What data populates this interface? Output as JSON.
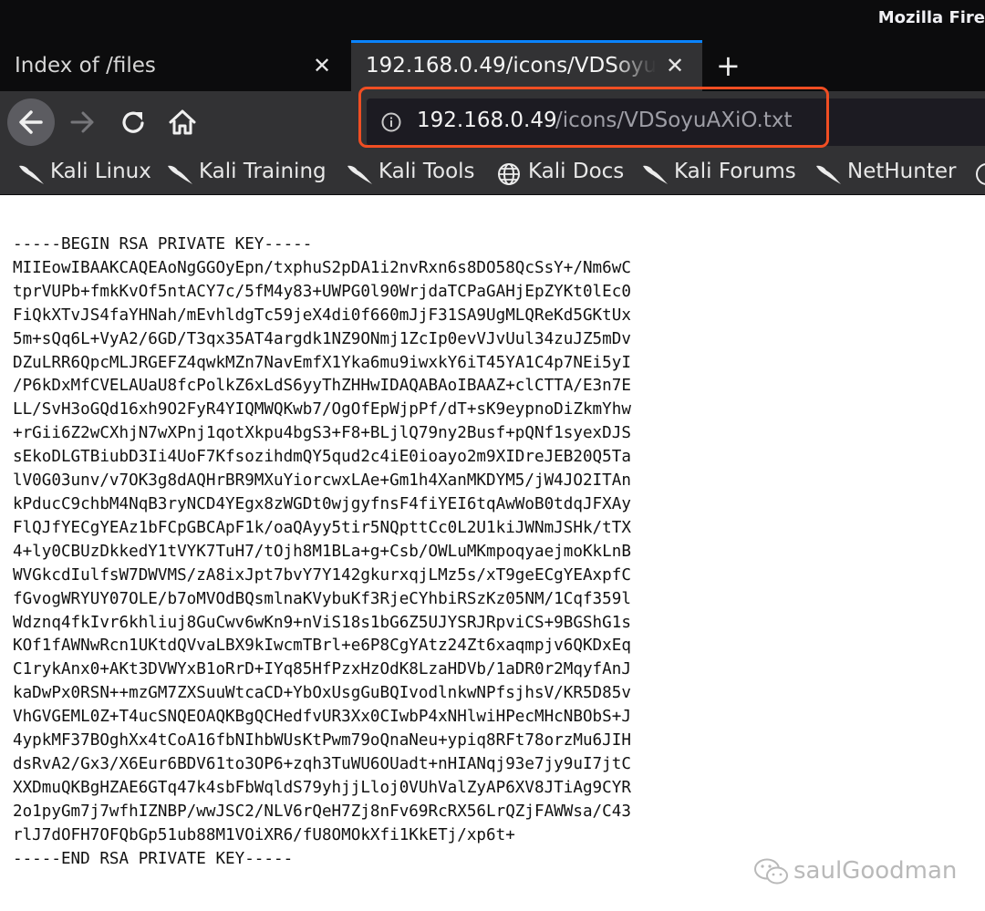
{
  "window": {
    "title": "Mozilla Fire"
  },
  "tabs": [
    {
      "label": "Index of /files",
      "active": false
    },
    {
      "label": "192.168.0.49/icons/VDSoyuAXiO.txt",
      "active": true
    }
  ],
  "nav": {
    "url_host": "192.168.0.49",
    "url_path": "/icons/VDSoyuAXiO.txt"
  },
  "bookmarks": [
    {
      "label": "Kali Linux",
      "icon": "kali-dragon-icon"
    },
    {
      "label": "Kali Training",
      "icon": "kali-dragon-icon"
    },
    {
      "label": "Kali Tools",
      "icon": "kali-dragon-icon"
    },
    {
      "label": "Kali Docs",
      "icon": "globe-icon"
    },
    {
      "label": "Kali Forums",
      "icon": "kali-dragon-icon"
    },
    {
      "label": "NetHunter",
      "icon": "kali-dragon-icon"
    }
  ],
  "document": {
    "lines": [
      "-----BEGIN RSA PRIVATE KEY-----",
      "MIIEowIBAAKCAQEAoNgGGOyEpn/txphuS2pDA1i2nvRxn6s8DO58QcSsY+/Nm6wC",
      "tprVUPb+fmkKvOf5ntACY7c/5fM4y83+UWPG0l90WrjdaTCPaGAHjEpZYKt0lEc0",
      "FiQkXTvJS4faYHNah/mEvhldgTc59jeX4di0f660mJjF31SA9UgMLQReKd5GKtUx",
      "5m+sQq6L+VyA2/6GD/T3qx35AT4argdk1NZ9ONmj1ZcIp0evVJvUul34zuJZ5mDv",
      "DZuLRR6QpcMLJRGEFZ4qwkMZn7NavEmfX1Yka6mu9iwxkY6iT45YA1C4p7NEi5yI",
      "/P6kDxMfCVELAUaU8fcPolkZ6xLdS6yyThZHHwIDAQABAoIBAAZ+clCTTA/E3n7E",
      "LL/SvH3oGQd16xh9O2FyR4YIQMWQKwb7/OgOfEpWjpPf/dT+sK9eypnoDiZkmYhw",
      "+rGii6Z2wCXhjN7wXPnj1qotXkpu4bgS3+F8+BLjlQ79ny2Busf+pQNf1syexDJS",
      "sEkoDLGTBiubD3Ii4UoF7KfsozihdmQY5qud2c4iE0ioayo2m9XIDreJEB20Q5Ta",
      "lV0G03unv/v7OK3g8dAQHrBR9MXuYiorcwxLAe+Gm1h4XanMKDYM5/jW4JO2ITAn",
      "kPducC9chbM4NqB3ryNCD4YEgx8zWGDt0wjgyfnsF4fiYEI6tqAwWoB0tdqJFXAy",
      "FlQJfYECgYEAz1bFCpGBCApF1k/oaQAyy5tir5NQpttCc0L2U1kiJWNmJSHk/tTX",
      "4+ly0CBUzDkkedY1tVYK7TuH7/tOjh8M1BLa+g+Csb/OWLuMKmpoqyaejmoKkLnB",
      "WVGkcdIulfsW7DWVMS/zA8ixJpt7bvY7Y142gkurxqjLMz5s/xT9geECgYEAxpfC",
      "fGvogWRYUY07OLE/b7oMVOdBQsmlnaKVybuKf3RjeCYhbiRSzKz05NM/1Cqf359l",
      "Wdznq4fkIvr6khliuj8GuCwv6wKn9+nViS18s1bG6Z5UJYSRJRpviCS+9BGShG1s",
      "KOf1fAWNwRcn1UKtdQVvaLBX9kIwcmTBrl+e6P8CgYAtz24Zt6xaqmpjv6QKDxEq",
      "C1rykAnx0+AKt3DVWYxB1oRrD+IYq85HfPzxHzOdK8LzaHDVb/1aDR0r2MqyfAnJ",
      "kaDwPx0RSN++mzGM7ZXSuuWtcaCD+YbOxUsgGuBQIvodlnkwNPfsjhsV/KR5D85v",
      "VhGVGEML0Z+T4ucSNQEOAQKBgQCHedfvUR3Xx0CIwbP4xNHlwiHPecMHcNBObS+J",
      "4ypkMF37BOghXx4tCoA16fbNIhbWUsKtPwm79oQnaNeu+ypiq8RFt78orzMu6JIH",
      "dsRvA2/Gx3/X6Eur6BDV61to3OP6+zqh3TuWU6OUadt+nHIANqj93e7jy9uI7jtC",
      "XXDmuQKBgHZAE6GTq47k4sbFbWqldS79yhjjLloj0VUhValZyAP6XV8JTiAg9CYR",
      "2o1pyGm7j7wfhIZNBP/wwJSC2/NLV6rQeH7Zj8nFv69RcRX56LrQZjFAWWsa/C43",
      "rlJ7dOFH7OFQbGp51ub88M1VOiXR6/fU8OMOkXfi1KkETj/xp6t+",
      "-----END RSA PRIVATE KEY-----"
    ]
  },
  "watermark": {
    "text": "saulGoodman"
  }
}
